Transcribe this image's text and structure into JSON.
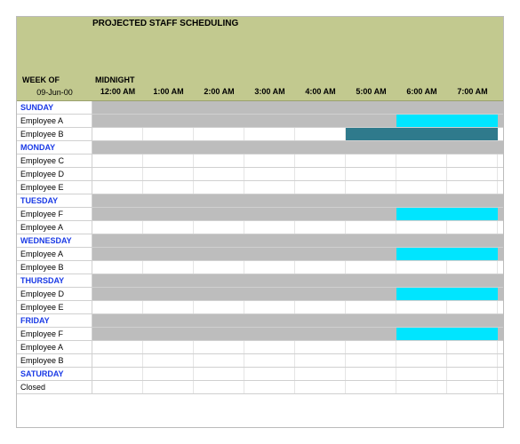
{
  "header": {
    "title": "PROJECTED STAFF SCHEDULING",
    "week_of_label": "WEEK OF",
    "midnight_label": "MIDNIGHT",
    "date": "09-Jun-00",
    "hours": [
      "12:00 AM",
      "1:00 AM",
      "2:00 AM",
      "3:00 AM",
      "4:00 AM",
      "5:00 AM",
      "6:00 AM",
      "7:00 AM"
    ]
  },
  "rows": [
    {
      "type": "day",
      "label": "SUNDAY",
      "full_gray": true
    },
    {
      "type": "emp",
      "label": "Employee A",
      "full_gray": true,
      "bars": [
        {
          "kind": "cyan",
          "start": 6,
          "end": 8
        }
      ]
    },
    {
      "type": "emp",
      "label": "Employee B",
      "bars": [
        {
          "kind": "teal",
          "start": 5,
          "end": 8
        }
      ]
    },
    {
      "type": "day",
      "label": "MONDAY",
      "full_gray": true
    },
    {
      "type": "emp",
      "label": "Employee C"
    },
    {
      "type": "emp",
      "label": "Employee D"
    },
    {
      "type": "emp",
      "label": "Employee E"
    },
    {
      "type": "day",
      "label": "TUESDAY",
      "full_gray": true
    },
    {
      "type": "emp",
      "label": "Employee F",
      "full_gray": true,
      "bars": [
        {
          "kind": "cyan",
          "start": 6,
          "end": 8
        }
      ]
    },
    {
      "type": "emp",
      "label": "Employee A"
    },
    {
      "type": "day",
      "label": "WEDNESDAY",
      "full_gray": true
    },
    {
      "type": "emp",
      "label": "Employee A",
      "full_gray": true,
      "bars": [
        {
          "kind": "cyan",
          "start": 6,
          "end": 8
        }
      ]
    },
    {
      "type": "emp",
      "label": "Employee B"
    },
    {
      "type": "day",
      "label": "THURSDAY",
      "full_gray": true
    },
    {
      "type": "emp",
      "label": "Employee D",
      "full_gray": true,
      "bars": [
        {
          "kind": "cyan",
          "start": 6,
          "end": 8
        }
      ]
    },
    {
      "type": "emp",
      "label": "Employee E"
    },
    {
      "type": "day",
      "label": "FRIDAY",
      "full_gray": true
    },
    {
      "type": "emp",
      "label": "Employee F",
      "full_gray": true,
      "bars": [
        {
          "kind": "cyan",
          "start": 6,
          "end": 8
        }
      ]
    },
    {
      "type": "emp",
      "label": "Employee A"
    },
    {
      "type": "emp",
      "label": "Employee B"
    },
    {
      "type": "day",
      "label": "SATURDAY"
    },
    {
      "type": "emp",
      "label": "Closed"
    }
  ],
  "chart_data": {
    "type": "table",
    "title": "Projected Staff Scheduling",
    "week_of": "09-Jun-00",
    "columns_hours": [
      "12:00 AM",
      "1:00 AM",
      "2:00 AM",
      "3:00 AM",
      "4:00 AM",
      "5:00 AM",
      "6:00 AM",
      "7:00 AM"
    ],
    "schedule": [
      {
        "day": "SUNDAY",
        "staff": [
          {
            "name": "Employee A",
            "span": [
              6,
              8
            ],
            "color": "cyan"
          },
          {
            "name": "Employee B",
            "span": [
              5,
              8
            ],
            "color": "teal"
          }
        ]
      },
      {
        "day": "MONDAY",
        "staff": [
          {
            "name": "Employee C",
            "span": null
          },
          {
            "name": "Employee D",
            "span": null
          },
          {
            "name": "Employee E",
            "span": null
          }
        ]
      },
      {
        "day": "TUESDAY",
        "staff": [
          {
            "name": "Employee F",
            "span": [
              6,
              8
            ],
            "color": "cyan"
          },
          {
            "name": "Employee A",
            "span": null
          }
        ]
      },
      {
        "day": "WEDNESDAY",
        "staff": [
          {
            "name": "Employee A",
            "span": [
              6,
              8
            ],
            "color": "cyan"
          },
          {
            "name": "Employee B",
            "span": null
          }
        ]
      },
      {
        "day": "THURSDAY",
        "staff": [
          {
            "name": "Employee D",
            "span": [
              6,
              8
            ],
            "color": "cyan"
          },
          {
            "name": "Employee E",
            "span": null
          }
        ]
      },
      {
        "day": "FRIDAY",
        "staff": [
          {
            "name": "Employee F",
            "span": [
              6,
              8
            ],
            "color": "cyan"
          },
          {
            "name": "Employee A",
            "span": null
          },
          {
            "name": "Employee B",
            "span": null
          }
        ]
      },
      {
        "day": "SATURDAY",
        "staff": [
          {
            "name": "Closed",
            "span": null
          }
        ]
      }
    ]
  }
}
